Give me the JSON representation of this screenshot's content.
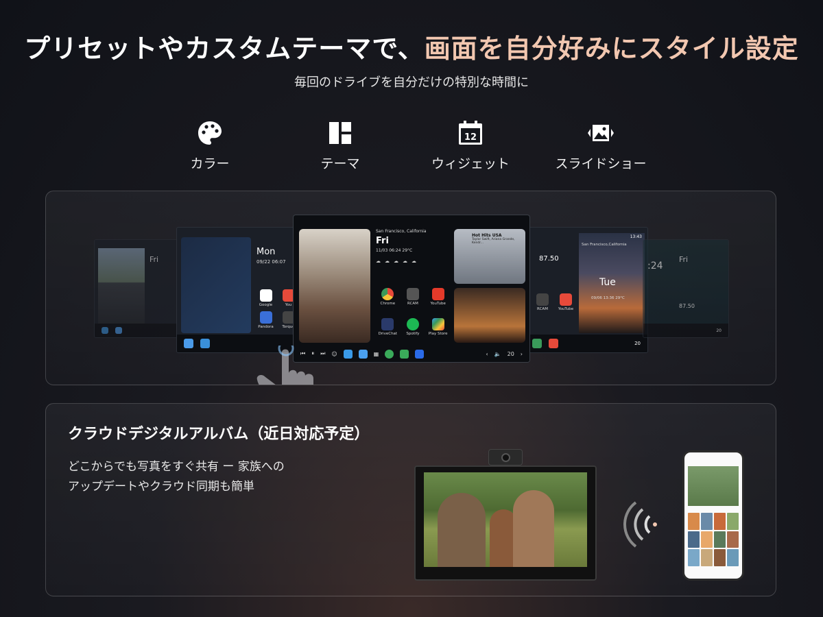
{
  "header": {
    "headline_part1": "プリセットやカスタムテーマで、",
    "headline_part2": "画面を自分好みにスタイル設定",
    "subhead": "毎回のドライブを自分だけの特別な時間に"
  },
  "features": [
    {
      "label": "カラー",
      "icon": "palette-icon"
    },
    {
      "label": "テーマ",
      "icon": "layout-icon"
    },
    {
      "label": "ウィジェット",
      "icon": "calendar-icon",
      "icon_text": "12"
    },
    {
      "label": "スライドショー",
      "icon": "slideshow-icon"
    }
  ],
  "carousel": {
    "left_screen": {
      "day": "Mon",
      "date": "09/22 06:07",
      "apps": [
        "Google",
        "Pandora",
        "You",
        "Torque"
      ]
    },
    "far_left_screen": {
      "day": "Fri"
    },
    "main_screen": {
      "city": "San Francisco, California",
      "day": "Fri",
      "date": "11/03 06:24 29°C",
      "music_title": "Hot Hits USA",
      "music_sub": "Taylor Swift, Ariana Grande, Kendr...",
      "apps": [
        "Chrome",
        "RCAM",
        "YouTube",
        "DriveChat",
        "Spotify",
        "Play Store"
      ],
      "volume": "20"
    },
    "right_screen": {
      "city": "San Francisco,California",
      "day": "Tue",
      "date": "09/06 13:36 29°C",
      "time": "13:43",
      "radio": "87.50",
      "apps": [
        "RCAM",
        "YouTube"
      ],
      "volume": "20"
    },
    "far_right_screen": {
      "day": "Fri",
      "time": ":24",
      "radio": "87.50",
      "volume": "20"
    }
  },
  "album": {
    "title": "クラウドデジタルアルバム（近日対応予定）",
    "line1": "どこからでも写真をすぐ共有 ー 家族への",
    "line2": "アップデートやクラウド同期も簡単"
  },
  "colors": {
    "accent": "#f2c7b0",
    "background": "#14161c"
  }
}
